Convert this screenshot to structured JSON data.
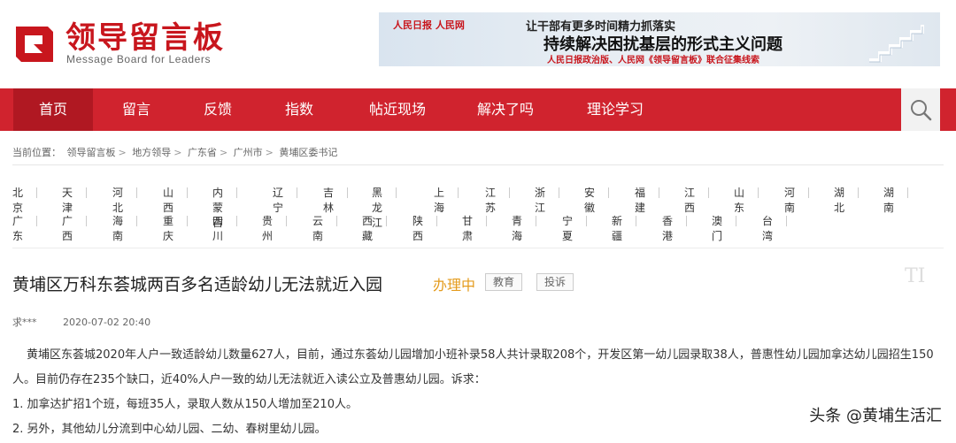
{
  "logo": {
    "cn": "领导留言板",
    "en": "Message Board for Leaders",
    "brand_color": "#c8161d"
  },
  "banner": {
    "left": "人民日报 人民网",
    "line1": "让干部有更多时间精力抓落实",
    "line2": "持续解决困扰基层的形式主义问题",
    "line3": "人民日报政治版、人民网《领导留言板》联合征集线索"
  },
  "nav": {
    "items": [
      "首页",
      "留言",
      "反馈",
      "指数",
      "帖近现场",
      "解决了吗",
      "理论学习"
    ],
    "active_index": 0,
    "color": "#d0232e"
  },
  "breadcrumb": [
    "当前位置：",
    "领导留言板",
    "地方领导",
    "广东省",
    "广州市",
    "黄埔区委书记"
  ],
  "regions": {
    "row1": [
      "北京",
      "天津",
      "河北",
      "山西",
      "内蒙古",
      "辽宁",
      "吉林",
      "黑龙江",
      "上海",
      "江苏",
      "浙江",
      "安徽",
      "福建",
      "江西",
      "山东",
      "河南",
      "湖北",
      "湖南"
    ],
    "row2": [
      "广东",
      "广西",
      "海南",
      "重庆",
      "四川",
      "贵州",
      "云南",
      "西藏",
      "陕西",
      "甘肃",
      "青海",
      "宁夏",
      "新疆",
      "香港",
      "澳门",
      "台湾"
    ]
  },
  "post": {
    "title": "黄埔区万科东荟城两百多名适龄幼儿无法就近入园",
    "status": "办理中",
    "status_color": "#e49b1d",
    "tags": [
      "教育",
      "投诉"
    ],
    "corner": "TI",
    "author": "求***",
    "datetime": "2020-07-02 20:40",
    "paragraph": "黄埔区东荟城2020年人户一致适龄幼儿数量627人，目前，通过东荟幼儿园增加小班补录58人共计录取208个，开发区第一幼儿园录取38人，普惠性幼儿园加拿达幼儿园招生150人。目前仍存在235个缺口，近40%人户一致的幼儿无法就近入读公立及普惠幼儿园。诉求：",
    "item1": "1. 加拿达扩招1个班，每班35人，录取人数从150人增加至210人。",
    "item2": "2. 另外，其他幼儿分流到中心幼儿园、二幼、春树里幼儿园。"
  },
  "watermark": "头条 @黄埔生活汇"
}
